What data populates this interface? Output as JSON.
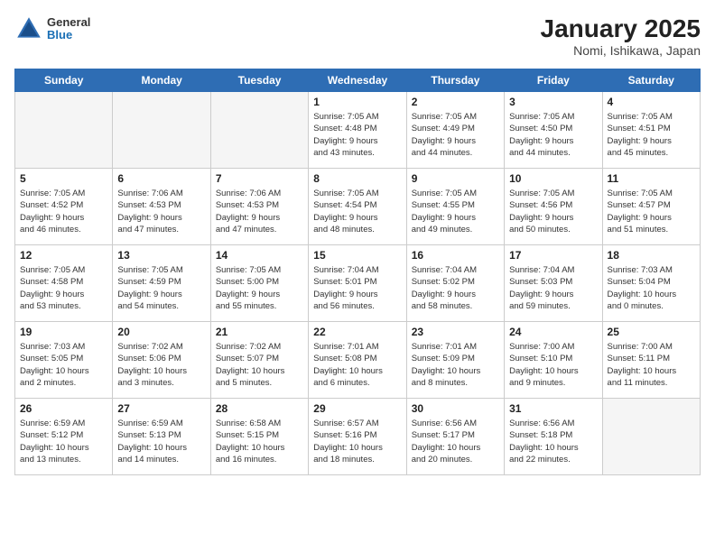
{
  "header": {
    "logo_general": "General",
    "logo_blue": "Blue",
    "title": "January 2025",
    "subtitle": "Nomi, Ishikawa, Japan"
  },
  "weekdays": [
    "Sunday",
    "Monday",
    "Tuesday",
    "Wednesday",
    "Thursday",
    "Friday",
    "Saturday"
  ],
  "weeks": [
    [
      {
        "day": "",
        "info": ""
      },
      {
        "day": "",
        "info": ""
      },
      {
        "day": "",
        "info": ""
      },
      {
        "day": "1",
        "info": "Sunrise: 7:05 AM\nSunset: 4:48 PM\nDaylight: 9 hours\nand 43 minutes."
      },
      {
        "day": "2",
        "info": "Sunrise: 7:05 AM\nSunset: 4:49 PM\nDaylight: 9 hours\nand 44 minutes."
      },
      {
        "day": "3",
        "info": "Sunrise: 7:05 AM\nSunset: 4:50 PM\nDaylight: 9 hours\nand 44 minutes."
      },
      {
        "day": "4",
        "info": "Sunrise: 7:05 AM\nSunset: 4:51 PM\nDaylight: 9 hours\nand 45 minutes."
      }
    ],
    [
      {
        "day": "5",
        "info": "Sunrise: 7:05 AM\nSunset: 4:52 PM\nDaylight: 9 hours\nand 46 minutes."
      },
      {
        "day": "6",
        "info": "Sunrise: 7:06 AM\nSunset: 4:53 PM\nDaylight: 9 hours\nand 47 minutes."
      },
      {
        "day": "7",
        "info": "Sunrise: 7:06 AM\nSunset: 4:53 PM\nDaylight: 9 hours\nand 47 minutes."
      },
      {
        "day": "8",
        "info": "Sunrise: 7:05 AM\nSunset: 4:54 PM\nDaylight: 9 hours\nand 48 minutes."
      },
      {
        "day": "9",
        "info": "Sunrise: 7:05 AM\nSunset: 4:55 PM\nDaylight: 9 hours\nand 49 minutes."
      },
      {
        "day": "10",
        "info": "Sunrise: 7:05 AM\nSunset: 4:56 PM\nDaylight: 9 hours\nand 50 minutes."
      },
      {
        "day": "11",
        "info": "Sunrise: 7:05 AM\nSunset: 4:57 PM\nDaylight: 9 hours\nand 51 minutes."
      }
    ],
    [
      {
        "day": "12",
        "info": "Sunrise: 7:05 AM\nSunset: 4:58 PM\nDaylight: 9 hours\nand 53 minutes."
      },
      {
        "day": "13",
        "info": "Sunrise: 7:05 AM\nSunset: 4:59 PM\nDaylight: 9 hours\nand 54 minutes."
      },
      {
        "day": "14",
        "info": "Sunrise: 7:05 AM\nSunset: 5:00 PM\nDaylight: 9 hours\nand 55 minutes."
      },
      {
        "day": "15",
        "info": "Sunrise: 7:04 AM\nSunset: 5:01 PM\nDaylight: 9 hours\nand 56 minutes."
      },
      {
        "day": "16",
        "info": "Sunrise: 7:04 AM\nSunset: 5:02 PM\nDaylight: 9 hours\nand 58 minutes."
      },
      {
        "day": "17",
        "info": "Sunrise: 7:04 AM\nSunset: 5:03 PM\nDaylight: 9 hours\nand 59 minutes."
      },
      {
        "day": "18",
        "info": "Sunrise: 7:03 AM\nSunset: 5:04 PM\nDaylight: 10 hours\nand 0 minutes."
      }
    ],
    [
      {
        "day": "19",
        "info": "Sunrise: 7:03 AM\nSunset: 5:05 PM\nDaylight: 10 hours\nand 2 minutes."
      },
      {
        "day": "20",
        "info": "Sunrise: 7:02 AM\nSunset: 5:06 PM\nDaylight: 10 hours\nand 3 minutes."
      },
      {
        "day": "21",
        "info": "Sunrise: 7:02 AM\nSunset: 5:07 PM\nDaylight: 10 hours\nand 5 minutes."
      },
      {
        "day": "22",
        "info": "Sunrise: 7:01 AM\nSunset: 5:08 PM\nDaylight: 10 hours\nand 6 minutes."
      },
      {
        "day": "23",
        "info": "Sunrise: 7:01 AM\nSunset: 5:09 PM\nDaylight: 10 hours\nand 8 minutes."
      },
      {
        "day": "24",
        "info": "Sunrise: 7:00 AM\nSunset: 5:10 PM\nDaylight: 10 hours\nand 9 minutes."
      },
      {
        "day": "25",
        "info": "Sunrise: 7:00 AM\nSunset: 5:11 PM\nDaylight: 10 hours\nand 11 minutes."
      }
    ],
    [
      {
        "day": "26",
        "info": "Sunrise: 6:59 AM\nSunset: 5:12 PM\nDaylight: 10 hours\nand 13 minutes."
      },
      {
        "day": "27",
        "info": "Sunrise: 6:59 AM\nSunset: 5:13 PM\nDaylight: 10 hours\nand 14 minutes."
      },
      {
        "day": "28",
        "info": "Sunrise: 6:58 AM\nSunset: 5:15 PM\nDaylight: 10 hours\nand 16 minutes."
      },
      {
        "day": "29",
        "info": "Sunrise: 6:57 AM\nSunset: 5:16 PM\nDaylight: 10 hours\nand 18 minutes."
      },
      {
        "day": "30",
        "info": "Sunrise: 6:56 AM\nSunset: 5:17 PM\nDaylight: 10 hours\nand 20 minutes."
      },
      {
        "day": "31",
        "info": "Sunrise: 6:56 AM\nSunset: 5:18 PM\nDaylight: 10 hours\nand 22 minutes."
      },
      {
        "day": "",
        "info": ""
      }
    ]
  ]
}
